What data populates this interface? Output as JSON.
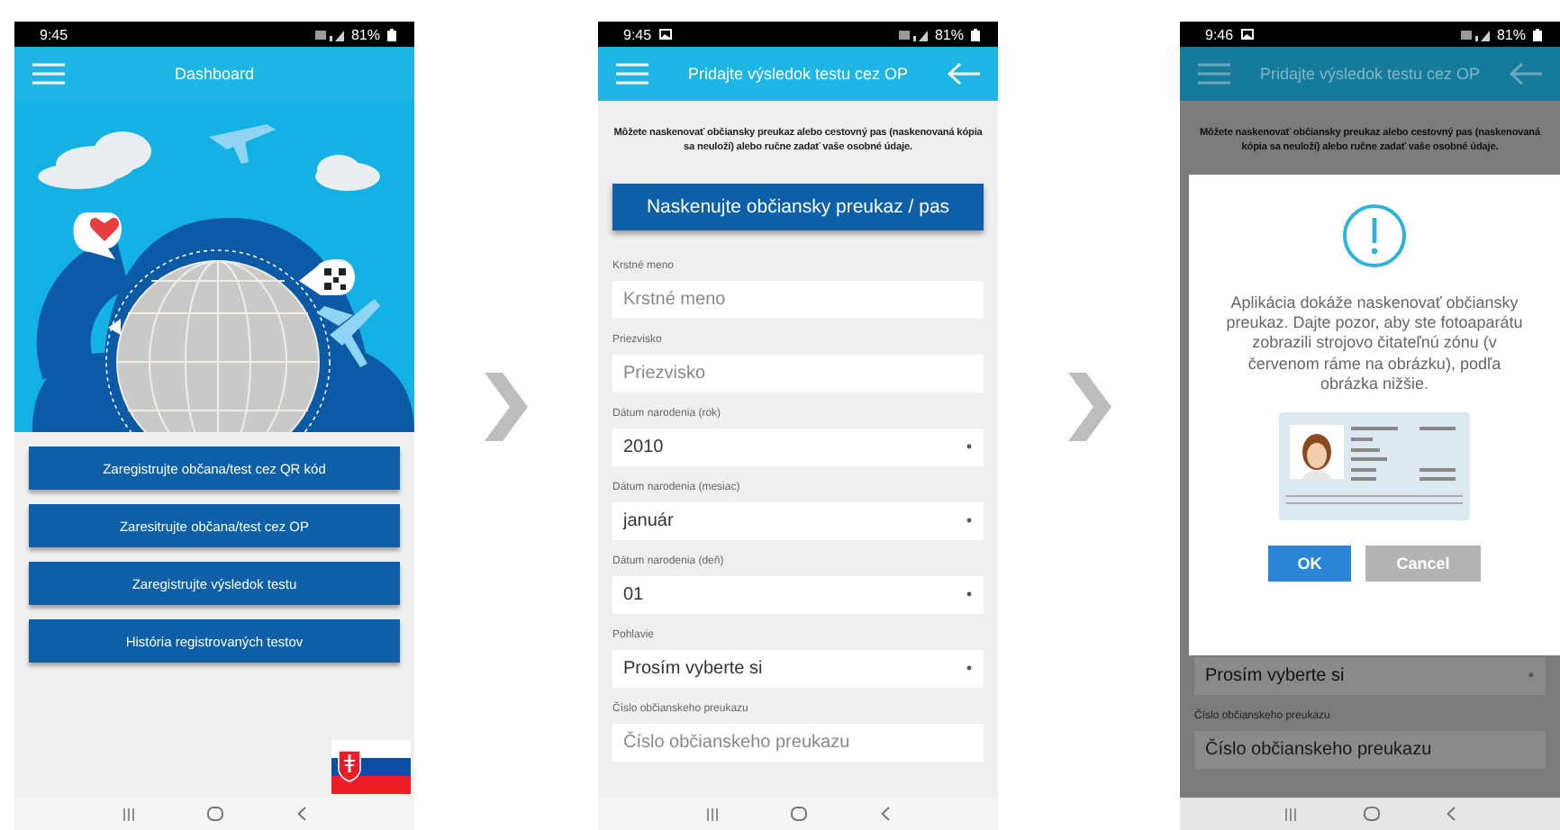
{
  "screens": [
    {
      "kind": "dashboard",
      "status": {
        "time": "9:45",
        "battery": "81%",
        "gallery": false
      },
      "title": "Dashboard",
      "nav_back": false,
      "buttons": [
        "Zaregistrujte občana/test cez QR kód",
        "Zaresitrujte občana/test cez OP",
        "Zaregistrujte výsledok testu",
        "História registrovaných testov"
      ]
    },
    {
      "kind": "form",
      "status": {
        "time": "9:45",
        "battery": "81%",
        "gallery": true
      },
      "title": "Pridajte výsledok testu cez OP",
      "nav_back": true,
      "intro": "Môžete naskenovať občiansky preukaz alebo cestovný pas (naskenovaná kópia sa neuloží) alebo ručne zadať vaše osobné údaje.",
      "scan_button": "Naskenujte občiansky preukaz / pas",
      "fields": [
        {
          "label": "Krstné meno",
          "kind": "text",
          "placeholder": "Krstné meno"
        },
        {
          "label": "Priezvisko",
          "kind": "text",
          "placeholder": "Priezvisko"
        },
        {
          "label": "Dátum narodenia (rok)",
          "kind": "select",
          "value": "2010"
        },
        {
          "label": "Dátum narodenia (mesiac)",
          "kind": "select",
          "value": "január"
        },
        {
          "label": "Dátum narodenia (deň)",
          "kind": "select",
          "value": "01"
        },
        {
          "label": "Pohlavie",
          "kind": "select",
          "value": "Prosím vyberte si"
        },
        {
          "label": "Číslo občianskeho preukazu",
          "kind": "text",
          "placeholder": "Číslo občianskeho preukazu"
        }
      ]
    },
    {
      "kind": "dialog",
      "status": {
        "time": "9:46",
        "battery": "81%",
        "gallery": true
      },
      "title": "Pridajte výsledok testu cez OP",
      "nav_back": true,
      "intro": "Môžete naskenovať občiansky preukaz alebo cestovný pas (naskenovaná kópia sa neuloží) alebo ručne zadať vaše osobné údaje.",
      "dialog": {
        "message": "Aplikácia dokáže naskenovať občiansky preukaz. Dajte pozor, aby ste fotoaparátu zobrazili strojovo čitateľnú zónu (v červenom ráme na obrázku), podľa obrázka nižšie.",
        "buttons": [
          {
            "label": "OK",
            "kind": "primary"
          },
          {
            "label": "Cancel",
            "kind": "secondary"
          }
        ]
      },
      "fields": [
        {
          "kind": "select",
          "value": "Prosím vyberte si"
        },
        {
          "label": "Číslo občianskeho preukazu",
          "kind": "text",
          "placeholder": "Číslo občianskeho preukazu"
        }
      ]
    }
  ]
}
